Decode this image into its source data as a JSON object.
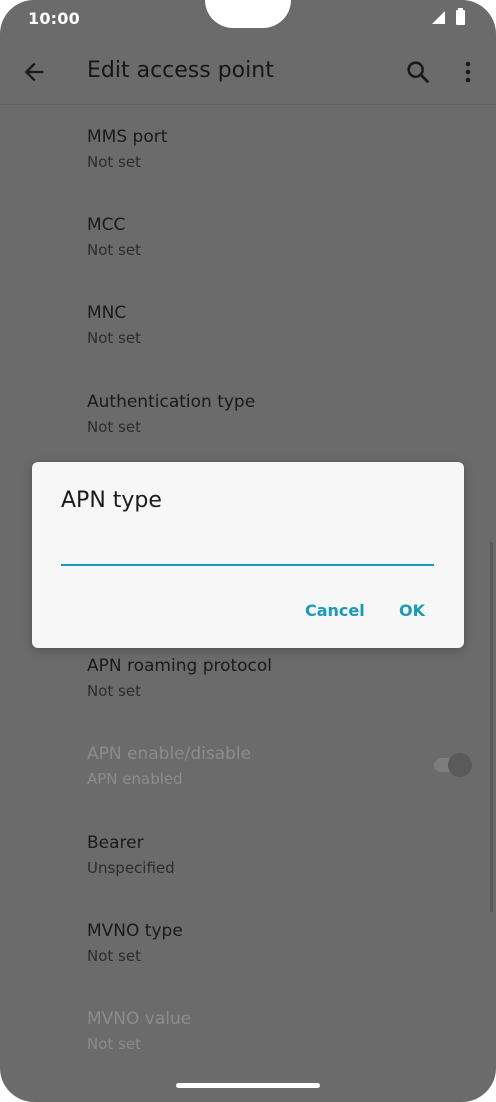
{
  "status_bar": {
    "time": "10:00"
  },
  "app_bar": {
    "title": "Edit access point"
  },
  "settings": [
    {
      "title": "MMS port",
      "summary": "Not set"
    },
    {
      "title": "MCC",
      "summary": "Not set"
    },
    {
      "title": "MNC",
      "summary": "Not set"
    },
    {
      "title": "Authentication type",
      "summary": "Not set"
    },
    {
      "title": "APN roaming protocol",
      "summary": "Not set"
    },
    {
      "title": "APN enable/disable",
      "summary": "APN enabled",
      "disabled": true,
      "toggle_on": true
    },
    {
      "title": "Bearer",
      "summary": "Unspecified"
    },
    {
      "title": "MVNO type",
      "summary": "Not set"
    },
    {
      "title": "MVNO value",
      "summary": "Not set",
      "disabled": true
    }
  ],
  "dialog": {
    "title": "APN type",
    "input_value": "",
    "cancel_label": "Cancel",
    "ok_label": "OK"
  },
  "colors": {
    "accent": "#1a9bb5",
    "scrim_background": "#6b6b6b",
    "dialog_background": "#f7f7f7"
  }
}
